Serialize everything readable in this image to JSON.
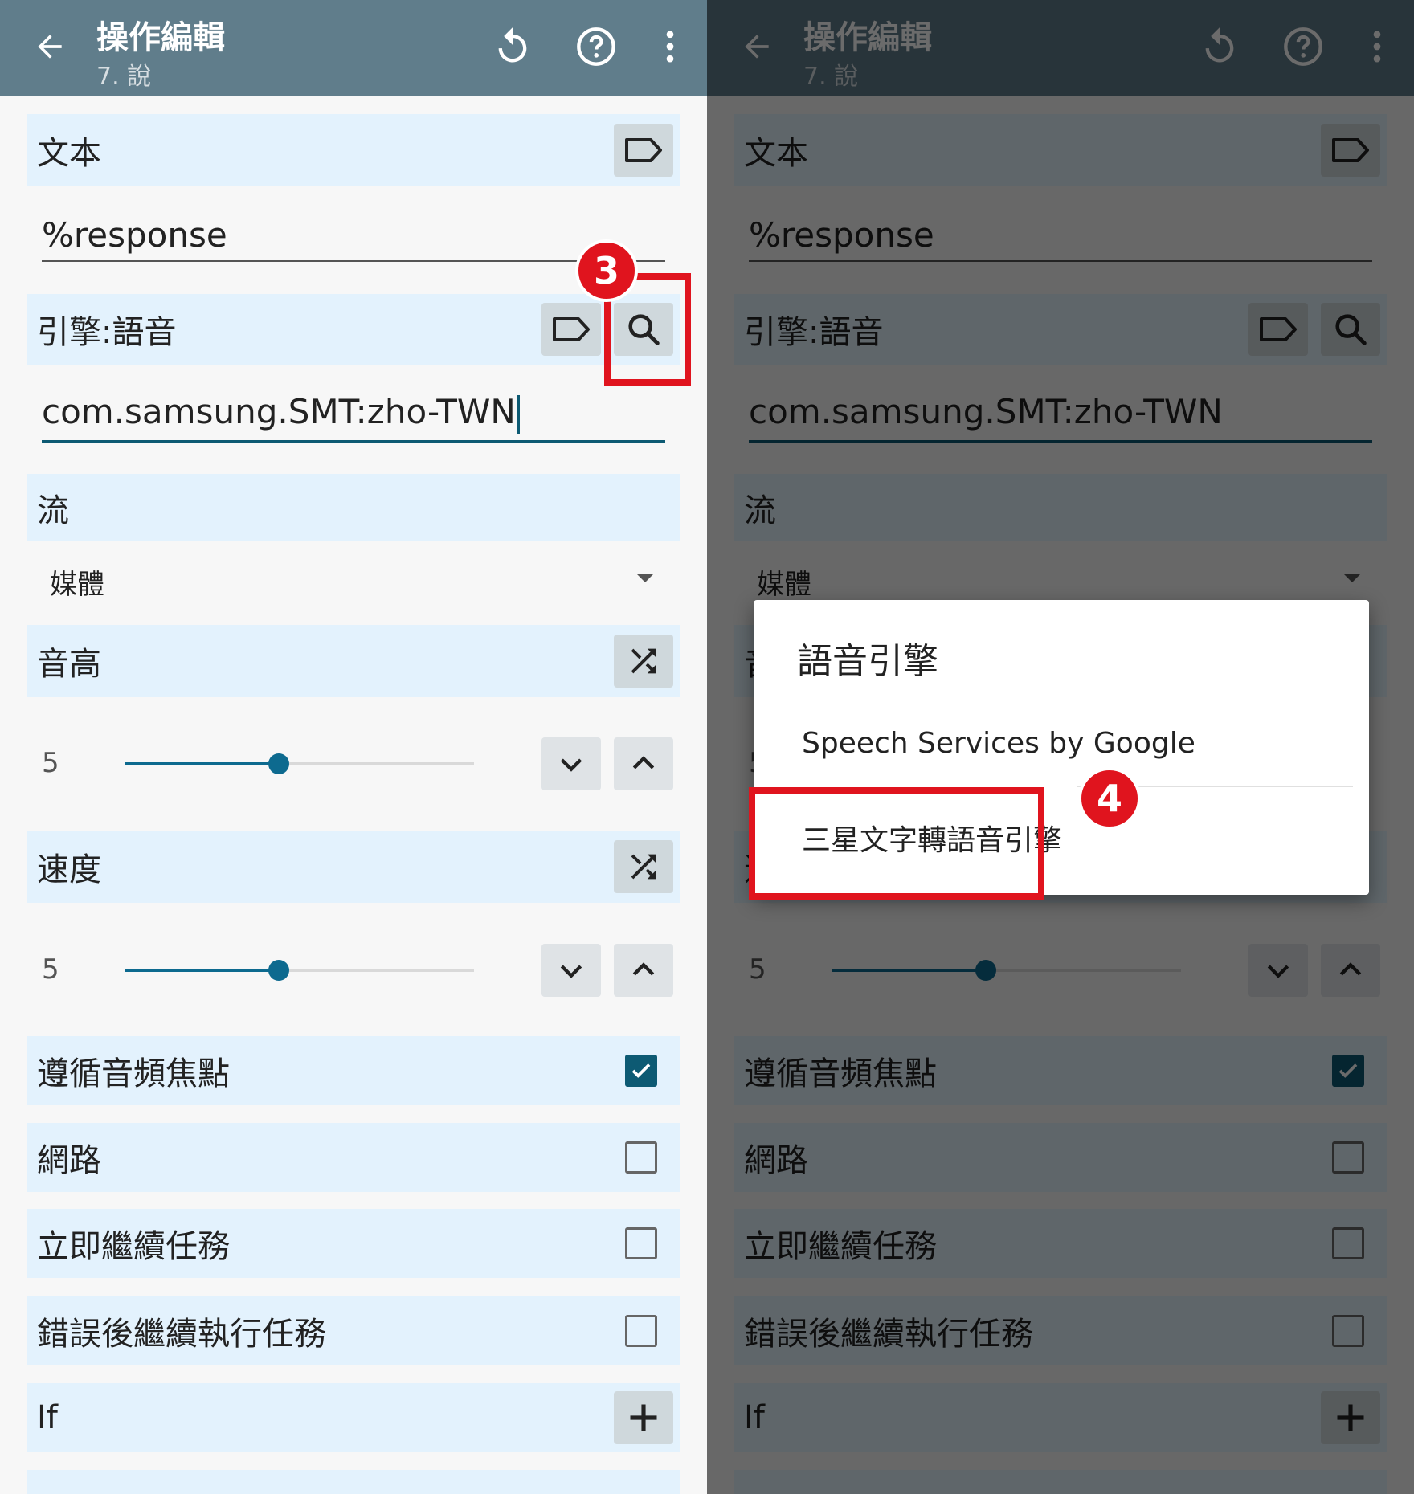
{
  "appbar": {
    "title": "操作編輯",
    "subtitle": "7. 說"
  },
  "sections": {
    "text_label": "文本",
    "text_value": "%response",
    "engine_label": "引擎:語音",
    "engine_value": "com.samsung.SMT:zho-TWN",
    "stream_label": "流",
    "stream_value": "媒體",
    "pitch_label": "音高",
    "pitch_value": "5",
    "pitch_fraction": 0.44,
    "speed_label": "速度",
    "speed_value": "5",
    "speed_fraction": 0.44,
    "respect_focus_label": "遵循音頻焦點",
    "respect_focus_checked": true,
    "network_label": "網路",
    "network_checked": false,
    "continue_label": "立即繼續任務",
    "continue_checked": false,
    "continue_error_label": "錯誤後繼續執行任務",
    "continue_error_checked": false,
    "if_label": "If"
  },
  "dialog": {
    "title": "語音引擎",
    "option1": "Speech Services by Google",
    "option2": "三星文字轉語音引擎"
  },
  "annotations": {
    "step3": "3",
    "step4": "4",
    "highlight_color": "#e0141e"
  },
  "colors": {
    "appbar": "#607d8b",
    "section": "#e3f2fd",
    "accent": "#0d6a8f"
  }
}
